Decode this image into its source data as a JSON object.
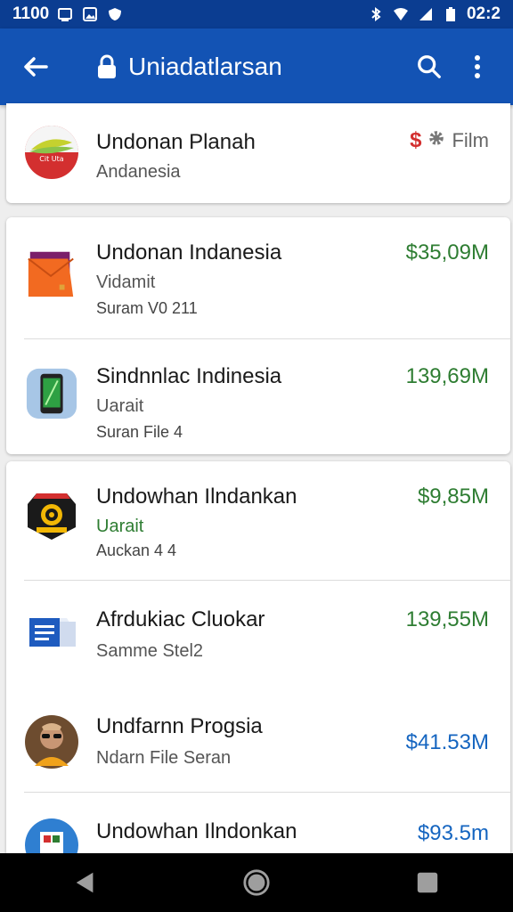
{
  "status_bar": {
    "time_left": "1100",
    "time_right": "02:2"
  },
  "app_bar": {
    "title": "Uniadatlarsan"
  },
  "top_card": {
    "name": "Undonan Planah",
    "sub": "Andanesia",
    "tag_label": "Film",
    "icon_text": "Cit Uta"
  },
  "items": [
    {
      "name": "Undonan Indanesia",
      "sub": "Vidamit",
      "meta": "Suram V0 211",
      "amount": "$35,09M",
      "amount_color": "#2e7d32",
      "icon": "folder-icon"
    },
    {
      "name": "Sindnnlac Indinesia",
      "sub": "Uarait",
      "meta": "Suran File 4",
      "amount": "139,69M",
      "amount_color": "#2e7d32",
      "icon": "phone-icon"
    },
    {
      "name": "Undowhan Ilndankan",
      "sub": "Uarait",
      "meta": "Auckan 4 4",
      "amount": "$9,85M",
      "amount_color": "#2e7d32",
      "icon": "camera-badge-icon"
    },
    {
      "name": "Afrdukiac Cluokar",
      "sub": "Samme Stel2",
      "meta": "",
      "amount": "139,55M",
      "amount_color": "#2e7d32",
      "icon": "document-icon"
    },
    {
      "name": "Undfarnn Progsia",
      "sub": "Ndarn File Seran",
      "meta": "",
      "amount": "$41.53M",
      "amount_color": "#1565c0",
      "icon": "avatar-icon"
    },
    {
      "name": "Undowhan Ilndonkan",
      "sub": "",
      "meta": "",
      "amount": "$93.5m",
      "amount_color": "#1565c0",
      "icon": "app-icon"
    }
  ],
  "colors": {
    "status_bar": "#0b3d91",
    "app_bar": "#1353b4",
    "green": "#2e7d32",
    "blue": "#1565c0"
  }
}
